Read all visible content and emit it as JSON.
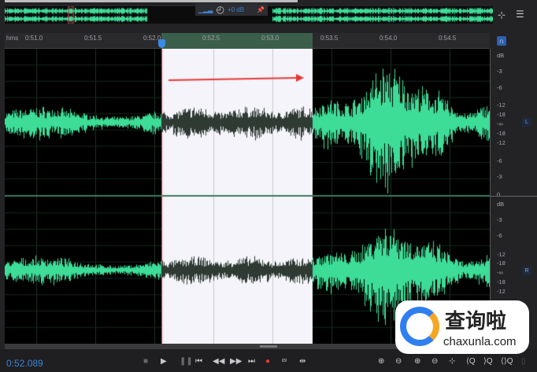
{
  "overview": {
    "gain_label": "+0 dB"
  },
  "ruler": {
    "unit": "hms",
    "ticks": [
      "0:51.0",
      "0:51.5",
      "0:52.0",
      "0:52.5",
      "0:53.0",
      "0:53.5",
      "0:54.0",
      "0:54.5"
    ]
  },
  "db_scale": {
    "left": {
      "labels": [
        "dB",
        "-3",
        "-6",
        "-12",
        "-18",
        "-∞",
        "-18",
        "-12",
        "-6",
        "-3",
        "0"
      ],
      "badge": "L"
    },
    "right": {
      "labels": [
        "dB",
        "-3",
        "-6",
        "-12",
        "-18",
        "-∞",
        "-18",
        "-12"
      ],
      "badge": "R"
    }
  },
  "transport": {
    "current_time": "0:52.089"
  },
  "selection": {
    "start": "0:52.089",
    "end_approx": "0:53.4"
  },
  "colors": {
    "waveform": "#3ddc97",
    "waveform_selected": "#2f3a33",
    "selection_bg": "#f4f4fa",
    "time": "#3c86d8",
    "arrow": "#e53935"
  },
  "watermark": {
    "cn": "查询啦",
    "url": "chaxunla.com"
  }
}
